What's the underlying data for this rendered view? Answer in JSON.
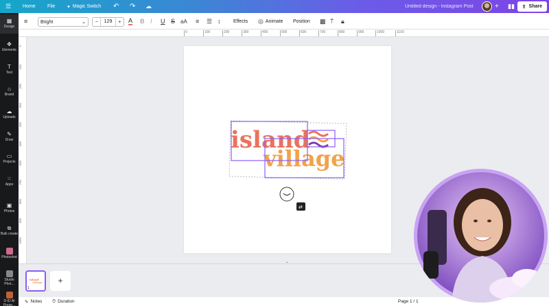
{
  "topbar": {
    "home": "Home",
    "file": "File",
    "magic_switch": "Magic Switch",
    "doc_title": "Untitled design - Instagram Post",
    "share": "Share"
  },
  "rail": {
    "items": [
      {
        "label": "Design",
        "icon": "design-icon"
      },
      {
        "label": "Elements",
        "icon": "elements-icon"
      },
      {
        "label": "Text",
        "icon": "text-icon"
      },
      {
        "label": "Brand",
        "icon": "brand-icon"
      },
      {
        "label": "Uploads",
        "icon": "uploads-icon"
      },
      {
        "label": "Draw",
        "icon": "draw-icon"
      },
      {
        "label": "Projects",
        "icon": "projects-icon"
      },
      {
        "label": "Apps",
        "icon": "apps-icon"
      },
      {
        "label": "Photos",
        "icon": "photos-icon"
      },
      {
        "label": "Bulk create",
        "icon": "bulk-create-icon"
      },
      {
        "label": "Photoshot",
        "icon": "photoshot-icon"
      },
      {
        "label": "Studio Phot...",
        "icon": "studio-photo-icon"
      },
      {
        "label": "D-ID AI Prese...",
        "icon": "d-id-icon"
      }
    ]
  },
  "toolbar": {
    "font": "Bright",
    "size": "129",
    "minus": "−",
    "plus": "+",
    "effects": "Effects",
    "animate": "Animate",
    "position": "Position"
  },
  "ruler": {
    "h_ticks": [
      "0",
      "100",
      "200",
      "300",
      "400",
      "500",
      "600",
      "700",
      "800",
      "900",
      "1000",
      "1100"
    ],
    "v_ticks": [
      "0",
      "100",
      "200",
      "300",
      "400",
      "500",
      "600",
      "700",
      "800",
      "900",
      "1000"
    ]
  },
  "design": {
    "line1": "island",
    "line2": "village",
    "colors": {
      "coral": "#e8735e",
      "orange": "#f2a24a",
      "purple": "#7b3fb0",
      "select": "#8b5cf6"
    }
  },
  "pages": {
    "page_number": "1",
    "add": "+"
  },
  "footer": {
    "notes": "Notes",
    "duration": "Duration",
    "page_indicator": "Page 1 / 1"
  }
}
